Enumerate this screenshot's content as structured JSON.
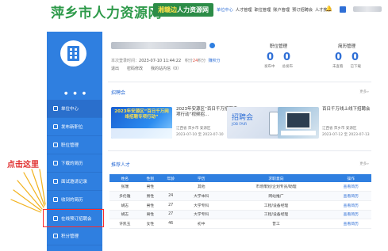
{
  "header": {
    "logo": "萍乡市人力资源网",
    "badge_prefix": "湘赣边",
    "badge_suffix": "人力资源网",
    "nav": [
      "单位中心",
      "人才管理",
      "职位管理",
      "账户管理",
      "预订招聘会",
      "人才搜索"
    ]
  },
  "sidebar": {
    "items": [
      {
        "label": "单位中心"
      },
      {
        "label": "发布新职位"
      },
      {
        "label": "职位管理"
      },
      {
        "label": "下载的简历"
      },
      {
        "label": "面试邀请记录"
      },
      {
        "label": "收到的简历"
      },
      {
        "label": "在线预订招聘会"
      },
      {
        "label": "积分管理"
      }
    ]
  },
  "annotation": {
    "text": "点击这里"
  },
  "profile": {
    "last_login_label": "本次登录时间：",
    "last_login_value": "2023-07-10 11:44:22",
    "points_label": "积分",
    "points_value": "24",
    "points_unit": "积分",
    "points_link": "赚积分",
    "actions": [
      "退出",
      "密码修改",
      "我的站内信（0）"
    ]
  },
  "stats": {
    "job_mgmt": {
      "title": "职位管理",
      "nums": [
        "0",
        "0"
      ],
      "labels": [
        "发布中",
        "总发布"
      ]
    },
    "resume_mgmt": {
      "title": "简历管理",
      "nums": [
        "0",
        "0"
      ],
      "labels": [
        "未查看",
        "已下载"
      ]
    }
  },
  "fairs": {
    "title": "招聘会",
    "more": "更多»",
    "items": [
      {
        "thumb_text": "2023年安源区“百日千万网络招聘专项行动”",
        "title": "2023年安源区“百日千万招聘专项行动”视频招...",
        "location": "江西省 萍乡市 安源区",
        "dates": "2023-07-10 至 2023-07-10"
      },
      {
        "thumb_text": "招聘会",
        "thumb_sub": "JOB FAIR",
        "title": "",
        "location": "",
        "dates": ""
      },
      {
        "title": "百日千万线上线下招聘会",
        "location": "江西省 萍乡市 安源区",
        "dates": "2023-07-12 至 2023-07-13"
      }
    ]
  },
  "talents": {
    "title": "推荐人才",
    "more": "更多»",
    "headers": [
      "姓名",
      "性别",
      "年龄",
      "学历",
      "求职意向",
      "操作"
    ],
    "rows": [
      [
        "张瑞",
        "男性",
        "",
        "其他",
        "市场策划/企划专员/助理",
        "查看简历"
      ],
      [
        "多伦雅",
        "男性",
        "24",
        "大学本科",
        "网站推广",
        "查看简历"
      ],
      [
        "胡志",
        "男性",
        "27",
        "大学专科",
        "工程/设备经理",
        "查看简历"
      ],
      [
        "胡志",
        "男性",
        "27",
        "大学专科",
        "工程/设备经理",
        "查看简历"
      ],
      [
        "许凯玉",
        "女性",
        "46",
        "初中",
        "普工",
        "查看简历"
      ]
    ]
  }
}
